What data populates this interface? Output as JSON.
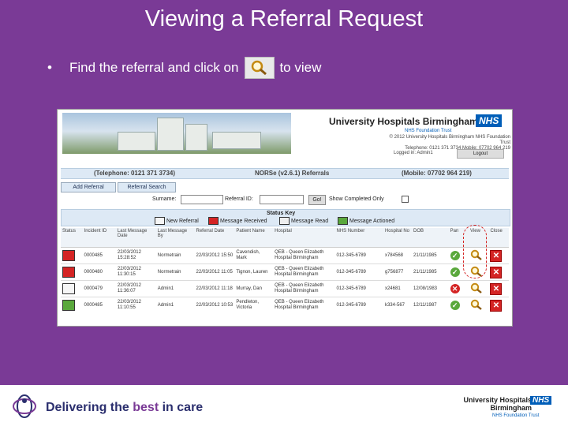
{
  "slide": {
    "title": "Viewing a Referral Request",
    "bullet_prefix": "•",
    "bullet_text_before": "Find the referral and click on",
    "bullet_text_after": "to view"
  },
  "app": {
    "org_name": "University Hospitals Birmingham",
    "nhs_badge": "NHS",
    "trust": "NHS Foundation Trust",
    "address_line1": "© 2012 University Hospitals Birmingham NHS Foundation Trust",
    "address_line2": "Telephone: 0121 371 3734  Mobile: 07702 964 219",
    "logged_in": "Logged in: Admin1",
    "logout_label": "Logout",
    "phone": "(Telephone: 0121 371 3734)",
    "app_title": "NORSe (v2.6.1) Referrals",
    "mobile": "(Mobile: 07702 964 219)",
    "tab_add": "Add Referral",
    "tab_search": "Referral Search",
    "search": {
      "surname_label": "Surname:",
      "referral_id_label": "Referral ID:",
      "go_label": "Go!",
      "show_completed_label": "Show Completed Only"
    },
    "status_key": {
      "title": "Status Key",
      "items": [
        "New Referral",
        "Message Received",
        "Message Read",
        "Message Actioned"
      ]
    },
    "columns": [
      "Status",
      "Incident ID",
      "Last Message Date",
      "Last Message By",
      "Referral Date",
      "Patient Name",
      "Hospital",
      "NHS Number",
      "Hospital No",
      "DOB",
      "Pan",
      "View",
      "Close"
    ],
    "rows": [
      {
        "id": "0000485",
        "last_date": "22/03/2012 15:28:52",
        "last_by": "Normetrain",
        "ref_date": "22/03/2012 15:50",
        "patient": "Cavendish, Mark",
        "hospital": "QEB - Queen Elizabeth Hospital Birmingham",
        "nhs": "012-345-6789",
        "hosp_no": "x784568",
        "dob": "21/11/1985",
        "pan": "ok"
      },
      {
        "id": "0000480",
        "last_date": "22/03/2012 11:30:15",
        "last_by": "Normetrain",
        "ref_date": "22/03/2012 11:05",
        "patient": "Tignon, Lauren",
        "hospital": "QEB - Queen Elizabeth Hospital Birmingham",
        "nhs": "012-345-6789",
        "hosp_no": "g756877",
        "dob": "21/11/1985",
        "pan": "ok"
      },
      {
        "id": "0000479",
        "last_date": "22/03/2012 11:36:07",
        "last_by": "Admin1",
        "ref_date": "22/03/2012 11:18",
        "patient": "Murray, Dan",
        "hospital": "QEB - Queen Elizabeth Hospital Birmingham",
        "nhs": "012-345-6789",
        "hosp_no": "x24681",
        "dob": "12/08/1983",
        "pan": "fail"
      },
      {
        "id": "0000485",
        "last_date": "22/03/2012 11:10:55",
        "last_by": "Admin1",
        "ref_date": "22/03/2012 10:53",
        "patient": "Pendleton, Victoria",
        "hospital": "QEB - Queen Elizabeth Hospital Birmingham",
        "nhs": "012-345-6789",
        "hosp_no": "k334-567",
        "dob": "12/11/1987",
        "pan": "ok"
      }
    ]
  },
  "footer": {
    "tagline_pre": "Delivering the ",
    "tagline_best": "best",
    "tagline_post": " in care",
    "org_line1": "University Hospitals",
    "org_line2": "Birmingham",
    "nhs_badge": "NHS",
    "trust": "NHS Foundation Trust"
  },
  "colors": {
    "background": "#7a3a96",
    "nhs_blue": "#005eb8",
    "highlight": "#d42424"
  }
}
